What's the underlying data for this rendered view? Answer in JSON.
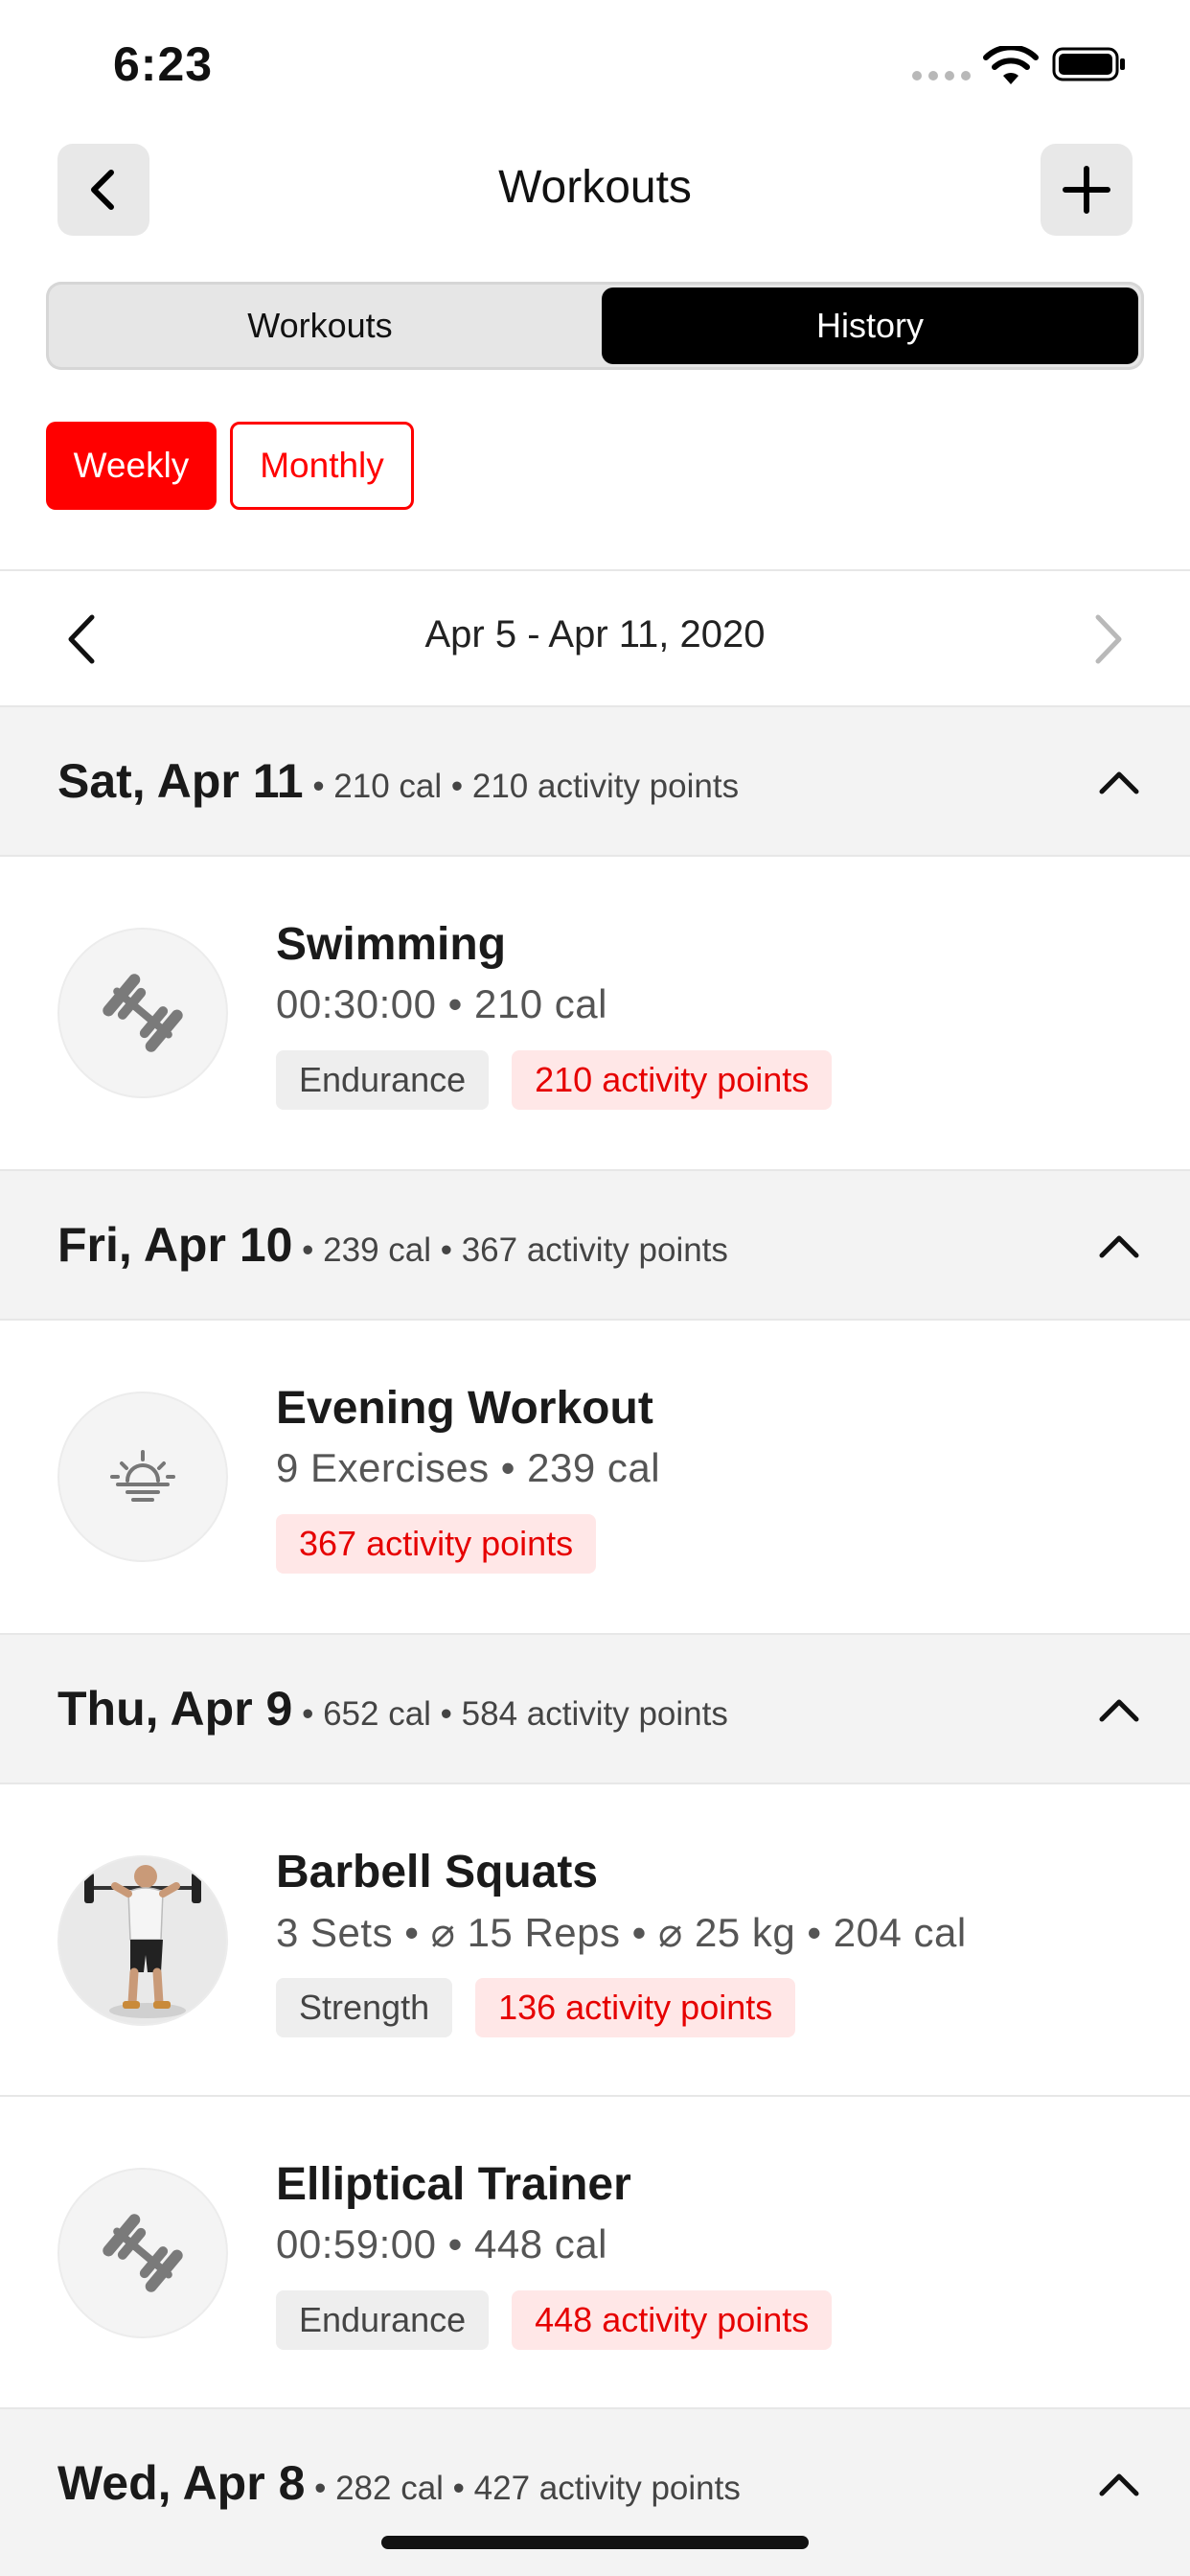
{
  "status_bar": {
    "time": "6:23"
  },
  "header": {
    "title": "Workouts"
  },
  "segments": {
    "left": "Workouts",
    "right": "History"
  },
  "filters": {
    "weekly": "Weekly",
    "monthly": "Monthly"
  },
  "date_range": {
    "label": "Apr 5 - Apr 11, 2020"
  },
  "days": [
    {
      "title": "Sat, Apr 11",
      "meta": " • 210 cal • 210 activity points",
      "workouts": [
        {
          "title": "Swimming",
          "subtitle": "00:30:00 • 210 cal",
          "category": "Endurance",
          "points": "210 activity points",
          "icon": "dumbbell-icon"
        }
      ]
    },
    {
      "title": "Fri, Apr 10",
      "meta": " • 239 cal • 367 activity points",
      "workouts": [
        {
          "title": "Evening Workout",
          "subtitle": "9 Exercises • 239 cal",
          "points": "367 activity points",
          "icon": "sunset-icon"
        }
      ]
    },
    {
      "title": "Thu, Apr 9",
      "meta": " • 652 cal • 584 activity points",
      "workouts": [
        {
          "title": "Barbell Squats",
          "subtitle": "3 Sets • ⌀ 15 Reps • ⌀ 25 kg • 204 cal",
          "category": "Strength",
          "points": "136 activity points",
          "icon": "barbell-squat-figure"
        },
        {
          "title": "Elliptical Trainer",
          "subtitle": "00:59:00 • 448 cal",
          "category": "Endurance",
          "points": "448 activity points",
          "icon": "dumbbell-icon"
        }
      ]
    },
    {
      "title": "Wed, Apr 8",
      "meta": " • 282 cal • 427 activity points",
      "workouts": []
    }
  ],
  "colors": {
    "accent": "#ff0000",
    "segment_active": "#000000",
    "points_bg": "#ffe7e7"
  }
}
